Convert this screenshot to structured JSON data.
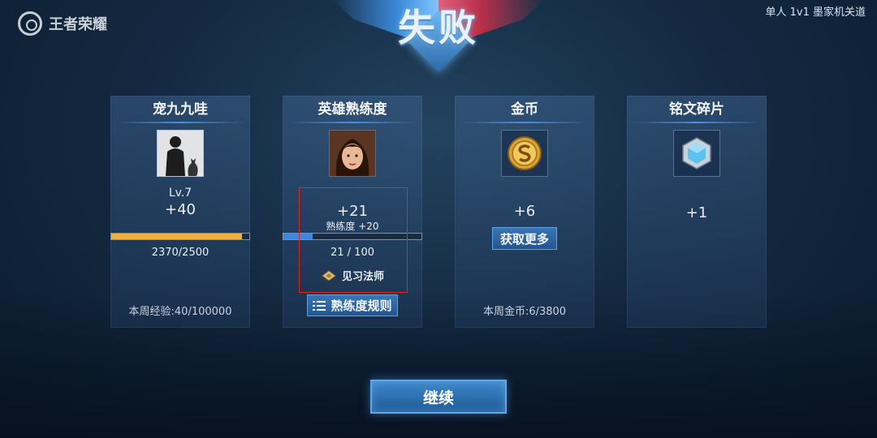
{
  "app": {
    "logo_text": "王者荣耀",
    "mode": "单人 1v1 墨家机关道"
  },
  "result": {
    "title": "失败"
  },
  "cards": {
    "player": {
      "title": "宠九九哇",
      "level": "Lv.7",
      "gain": "+40",
      "progress_text": "2370/2500",
      "progress_fraction": 0.948,
      "weekly": "本周经验:40/100000"
    },
    "mastery": {
      "title": "英雄熟练度",
      "gain": "+21",
      "sub": "熟练度 +20",
      "progress_text": "21 / 100",
      "progress_fraction": 0.21,
      "rank": "见习法师",
      "rules_button": "熟练度规则"
    },
    "coins": {
      "title": "金币",
      "gain": "+6",
      "more_button": "获取更多",
      "weekly": "本周金币:6/3800"
    },
    "inscription": {
      "title": "铭文碎片",
      "gain": "+1"
    }
  },
  "continue_button": "继续",
  "colors": {
    "accent_blue": "#3a76b6",
    "xp_bar": "#f0b040",
    "mastery_bar": "#3c86e0",
    "highlight_red": "#e0242a"
  }
}
